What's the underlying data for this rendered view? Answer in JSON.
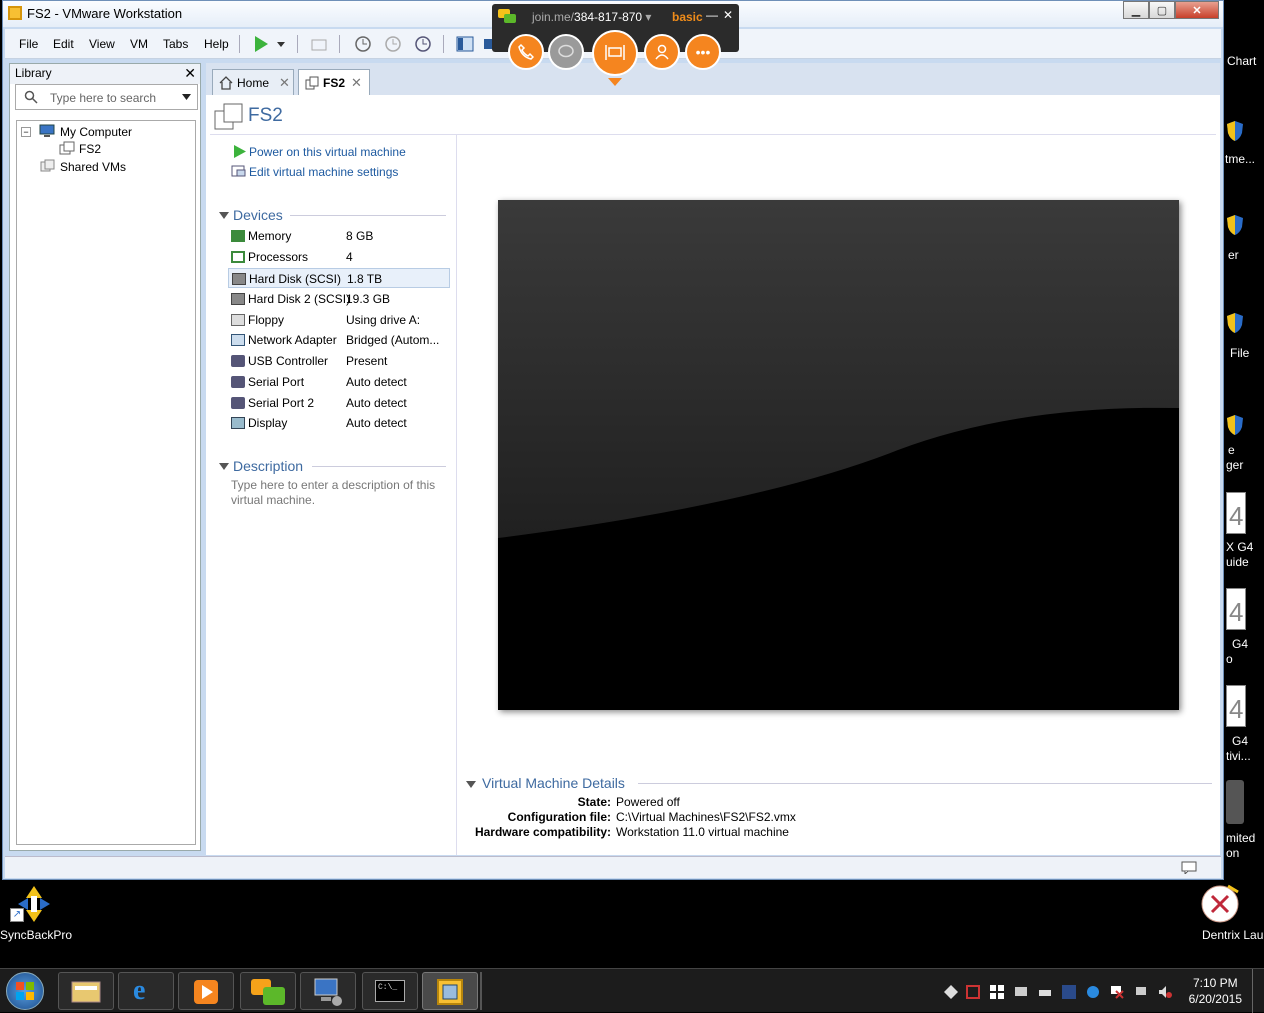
{
  "window": {
    "title": "FS2 - VMware Workstation"
  },
  "menu": [
    "File",
    "Edit",
    "View",
    "VM",
    "Tabs",
    "Help"
  ],
  "library": {
    "title": "Library",
    "search_placeholder": "Type here to search",
    "tree": {
      "root": "My Computer",
      "vm": "FS2",
      "shared": "Shared VMs"
    }
  },
  "tabs": [
    {
      "label": "Home"
    },
    {
      "label": "FS2"
    }
  ],
  "vm": {
    "name": "FS2",
    "actions": {
      "power_on": "Power on this virtual machine",
      "edit": "Edit virtual machine settings"
    },
    "devices_title": "Devices",
    "devices": [
      {
        "name": "Memory",
        "value": "8 GB",
        "icon": "memory-icon"
      },
      {
        "name": "Processors",
        "value": "4",
        "icon": "processor-icon"
      },
      {
        "name": "Hard Disk (SCSI)",
        "value": "1.8 TB",
        "icon": "hard-disk-icon"
      },
      {
        "name": "Hard Disk 2 (SCSI)",
        "value": "19.3 GB",
        "icon": "hard-disk-icon"
      },
      {
        "name": "Floppy",
        "value": "Using drive A:",
        "icon": "floppy-icon"
      },
      {
        "name": "Network Adapter",
        "value": "Bridged (Autom...",
        "icon": "network-icon"
      },
      {
        "name": "USB Controller",
        "value": "Present",
        "icon": "usb-icon"
      },
      {
        "name": "Serial Port",
        "value": "Auto detect",
        "icon": "serial-port-icon"
      },
      {
        "name": "Serial Port 2",
        "value": "Auto detect",
        "icon": "serial-port-icon"
      },
      {
        "name": "Display",
        "value": "Auto detect",
        "icon": "display-icon"
      }
    ],
    "description_title": "Description",
    "description_placeholder": "Type here to enter a description of this virtual machine.",
    "details_title": "Virtual Machine Details",
    "details": [
      {
        "label": "State:",
        "value": "Powered off"
      },
      {
        "label": "Configuration file:",
        "value": "C:\\Virtual Machines\\FS2\\FS2.vmx"
      },
      {
        "label": "Hardware compatibility:",
        "value": "Workstation 11.0 virtual machine"
      }
    ]
  },
  "joinme": {
    "prefix": "join.me/",
    "code": "384-817-870",
    "plan": "basic"
  },
  "desktop": {
    "icons": [
      {
        "label": "SyncBackPro"
      },
      {
        "label": "Dentrix Launcher"
      }
    ],
    "partial_labels": [
      "Chart",
      "tme...",
      "er",
      "File",
      "e",
      "ger",
      "X G4",
      "uide",
      "G4",
      "o",
      "G4",
      "tivi...",
      "mited",
      "on"
    ]
  },
  "clock": {
    "time": "7:10 PM",
    "date": "6/20/2015"
  },
  "colors": {
    "accent": "#3e6aa0",
    "link": "#1e5aa0",
    "joinme_orange": "#f5851f"
  }
}
